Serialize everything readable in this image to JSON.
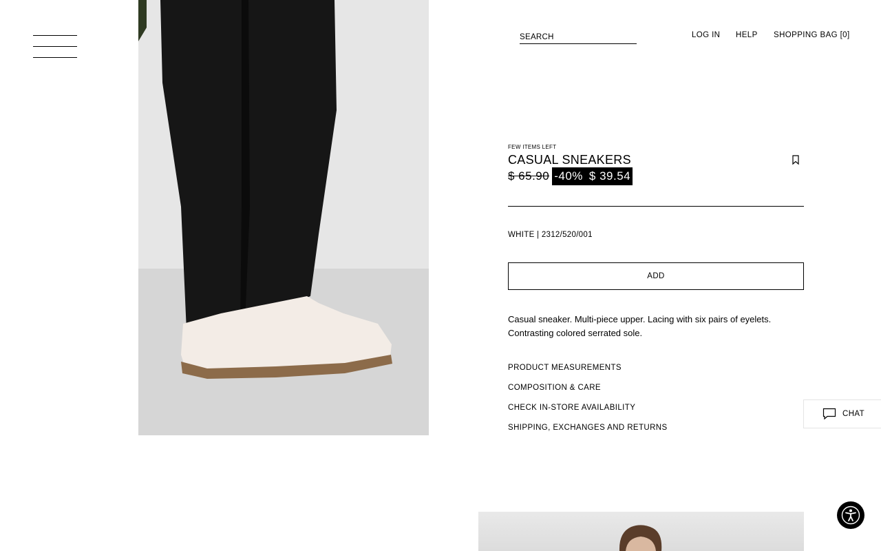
{
  "header": {
    "search_placeholder": "SEARCH",
    "login_label": "LOG IN",
    "help_label": "HELP",
    "bag_label": "SHOPPING BAG [0]"
  },
  "product": {
    "stock_note": "FEW ITEMS LEFT",
    "title": "CASUAL SNEAKERS",
    "old_price": "$ 65.90",
    "discount": "-40%",
    "sale_price": "$ 39.54",
    "color_ref": "WHITE | 2312/520/001",
    "add_label": "ADD",
    "description": "Casual sneaker. Multi-piece upper. Lacing with six pairs of eyelets. Contrasting colored serrated sole.",
    "sections": [
      "PRODUCT MEASUREMENTS",
      "COMPOSITION & CARE",
      "CHECK IN-STORE AVAILABILITY",
      "SHIPPING, EXCHANGES AND RETURNS"
    ]
  },
  "chat": {
    "label": "CHAT"
  },
  "icons": {
    "menu": "hamburger-menu-icon",
    "bookmark": "bookmark-icon",
    "chat": "chat-bubble-icon",
    "accessibility": "accessibility-icon"
  },
  "colors": {
    "text": "#000000",
    "background": "#ffffff",
    "sale_background": "#000000",
    "sale_text": "#ffffff"
  }
}
